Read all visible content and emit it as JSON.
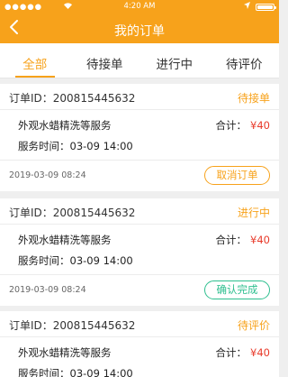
{
  "status_bar": {
    "signal": "●●●●●",
    "wifi": "wifi-icon",
    "time": "4:20 AM",
    "location": "location-icon",
    "battery": "battery-icon"
  },
  "nav": {
    "title": "我的订单",
    "back_icon": "back-chevron-icon"
  },
  "tabs": [
    {
      "label": "全部",
      "active": true
    },
    {
      "label": "待接单",
      "active": false
    },
    {
      "label": "进行中",
      "active": false
    },
    {
      "label": "待评价",
      "active": false
    }
  ],
  "colors": {
    "accent": "#f7a21b",
    "price": "#e83a2a",
    "confirm": "#2ebf8f"
  },
  "orders": [
    {
      "order_no": "订单ID：200815445632",
      "status": "待接单",
      "service": "外观水蜡精洗等服务",
      "service_time": "服务时间：03-09  14:00",
      "total_label": "合计：",
      "total_amount": "¥40",
      "created": "2019-03-09 08:24",
      "action": "取消订单"
    },
    {
      "order_no": "订单ID：200815445632",
      "status": "进行中",
      "service": "外观水蜡精洗等服务",
      "service_time": "服务时间：03-09  14:00",
      "total_label": "合计：",
      "total_amount": "¥40",
      "created": "2019-03-09 08:24",
      "action": "确认完成"
    },
    {
      "order_no": "订单ID：200815445632",
      "status": "待评价",
      "service": "外观水蜡精洗等服务",
      "service_time": "服务时间：03-09  14:00",
      "total_label": "合计：",
      "total_amount": "¥40"
    }
  ]
}
